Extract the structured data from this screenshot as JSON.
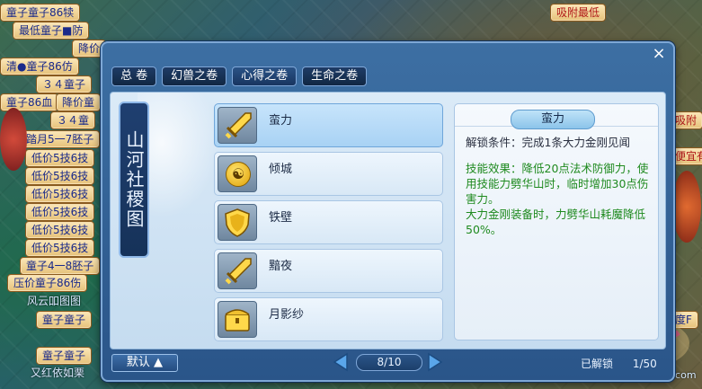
{
  "background": {
    "tags": [
      {
        "text": "童子童子86犊"
      },
      {
        "text": "最低童子■防"
      },
      {
        "text": "降价"
      },
      {
        "text": "清●童子86仿"
      },
      {
        "text": "３４童子"
      },
      {
        "text": "童子86血"
      },
      {
        "text": "降价童"
      },
      {
        "text": "３４童"
      },
      {
        "text": "踏月5一7胚子"
      },
      {
        "text": "低价5技6技"
      },
      {
        "text": "低价5技6技"
      },
      {
        "text": "低价5技6技"
      },
      {
        "text": "低价5技6技"
      },
      {
        "text": "低价5技6技"
      },
      {
        "text": "低价5技6技"
      },
      {
        "text": "童子4一8胚子"
      },
      {
        "text": "压价童子86伤"
      },
      {
        "text": "童子童子"
      },
      {
        "text": "童子童子"
      },
      {
        "text": "吸附最低"
      },
      {
        "text": "吸附"
      },
      {
        "text": "便宜有"
      },
      {
        "text": "度F"
      }
    ],
    "misc_text": [
      "风云吅图图",
      "又红依如栗"
    ],
    "watermark": "xyq.netease.com"
  },
  "window": {
    "close_label": "×",
    "tabs": [
      {
        "label": "总 卷"
      },
      {
        "label": "幻兽之卷"
      },
      {
        "label": "心得之卷"
      },
      {
        "label": "生命之卷"
      }
    ],
    "scroll_title": "山河社稷图",
    "skills": [
      {
        "label": "蛮力",
        "icon": "sword-icon"
      },
      {
        "label": "倾城",
        "icon": "yin-yang-icon"
      },
      {
        "label": "铁壁",
        "icon": "shield-icon"
      },
      {
        "label": "黯夜",
        "icon": "sword-icon"
      },
      {
        "label": "月影纱",
        "icon": "chest-icon"
      }
    ],
    "detail": {
      "title": "蛮力",
      "unlock_condition": "解锁条件：完成1条大力金刚见闻",
      "effect_1": "技能效果：降低20点法术防御力，使用技能力劈华山时，临时增加30点伤害力。",
      "effect_2": "大力金刚装备时，力劈华山耗魔降低50%。"
    },
    "footer": {
      "default_button": "默认 ▲",
      "page": "8/10",
      "unlocked_label": "已解锁",
      "unlocked_count": "1/50"
    }
  },
  "colors": {
    "window_blue": "#2a5589",
    "effect_green": "#1f8a1f",
    "tag_text_blue": "#1a2a8a",
    "tag_text_red": "#b01818"
  }
}
